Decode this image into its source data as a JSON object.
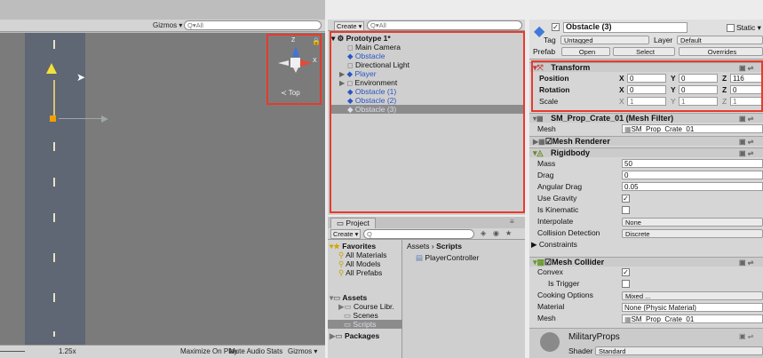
{
  "scene": {
    "toolbar": {
      "gizmos": "Gizmos ▾",
      "search_placeholder": "Q▾All"
    },
    "gizmo": {
      "y_label": "Z",
      "x_label": "X",
      "view_label": "≺ Top"
    },
    "bottom": {
      "zoom": "1.25x",
      "maximize": "Maximize On Play",
      "mute": "Mute Audio",
      "stats": "Stats",
      "gizmos": "Gizmos ▾"
    }
  },
  "hierarchy": {
    "create": "Create ▾",
    "search_placeholder": "Q▾All",
    "items": [
      {
        "label": "Prototype 1*",
        "bold": true
      },
      {
        "label": "Main Camera"
      },
      {
        "label": "Obstacle",
        "blue": true
      },
      {
        "label": "Directional Light"
      },
      {
        "label": "Player",
        "blue": true
      },
      {
        "label": "Environment"
      },
      {
        "label": "Obstacle (1)",
        "blue": true
      },
      {
        "label": "Obstacle (2)",
        "blue": true
      },
      {
        "label": "Obstacle (3)",
        "blue": true,
        "selected": true
      }
    ]
  },
  "project": {
    "tab": "Project",
    "create": "Create ▾",
    "search_placeholder": "Q",
    "favorites": "Favorites",
    "fav_items": [
      "All Materials",
      "All Models",
      "All Prefabs"
    ],
    "assets": "Assets",
    "asset_items": [
      "Course Libr.",
      "Scenes",
      "Scripts"
    ],
    "packages": "Packages",
    "breadcrumb_root": "Assets",
    "breadcrumb_sep": "›",
    "breadcrumb_current": "Scripts",
    "file": "PlayerController"
  },
  "inspector": {
    "object_name": "Obstacle (3)",
    "static_label": "Static ▾",
    "tag_label": "Tag",
    "tag_value": "Untagged",
    "layer_label": "Layer",
    "layer_value": "Default",
    "prefab_label": "Prefab",
    "prefab_open": "Open",
    "prefab_select": "Select",
    "prefab_overrides": "Overrides",
    "transform": {
      "title": "Transform",
      "position": {
        "label": "Position",
        "x": "0",
        "y": "0",
        "z": "116"
      },
      "rotation": {
        "label": "Rotation",
        "x": "0",
        "y": "0",
        "z": "0"
      },
      "scale": {
        "label": "Scale",
        "x": "1",
        "y": "1",
        "z": "1"
      }
    },
    "mesh_filter": {
      "title": "SM_Prop_Crate_01 (Mesh Filter)",
      "mesh_label": "Mesh",
      "mesh_value": "SM_Prop_Crate_01"
    },
    "mesh_renderer": {
      "title": "Mesh Renderer"
    },
    "rigidbody": {
      "title": "Rigidbody",
      "mass_label": "Mass",
      "mass": "50",
      "drag_label": "Drag",
      "drag": "0",
      "angular_label": "Angular Drag",
      "angular": "0.05",
      "gravity_label": "Use Gravity",
      "kinematic_label": "Is Kinematic",
      "interp_label": "Interpolate",
      "interp": "None",
      "collision_label": "Collision Detection",
      "collision": "Discrete",
      "constraints_label": "Constraints"
    },
    "mesh_collider": {
      "title": "Mesh Collider",
      "convex_label": "Convex",
      "trigger_label": "Is Trigger",
      "cooking_label": "Cooking Options",
      "cooking": "Mixed ...",
      "material_label": "Material",
      "material": "None (Physic Material)",
      "mesh_label": "Mesh",
      "mesh": "SM_Prop_Crate_01"
    },
    "material_section": {
      "name": "MilitaryProps",
      "shader_label": "Shader",
      "shader": "Standard"
    }
  },
  "colors": {
    "highlight": "#e83a2c",
    "prefab_blue": "#2a55c4"
  }
}
